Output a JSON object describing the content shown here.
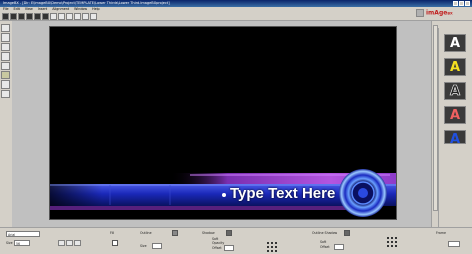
{
  "window": {
    "title": "ImageBX - [Dir: E\\ImageBX\\Demo\\Project\\TEMPLATE\\Lower Thirds\\Lower Third.ImageBXproject]"
  },
  "menu": [
    "File",
    "Edit",
    "View",
    "Insert",
    "Alignment",
    "Window",
    "Help"
  ],
  "logo": {
    "text": "imAge",
    "suffix": "BX"
  },
  "canvas": {
    "headline": "Type Text Here"
  },
  "styles": [
    {
      "glyph": "A",
      "color": "#ffffff"
    },
    {
      "glyph": "A",
      "color": "#f5e020"
    },
    {
      "glyph": "A",
      "color": "#202020"
    },
    {
      "glyph": "A",
      "color": "#f04040"
    },
    {
      "glyph": "A",
      "color": "#2050e0"
    }
  ],
  "properties": {
    "font_name": "Arial",
    "size_label": "Size",
    "size_value": "56",
    "fill_label": "Fill",
    "outline_label": "Outline",
    "outline_size_label": "Size",
    "shadow_label": "Shadow",
    "shadow_soft_label": "Soft",
    "shadow_opacity_label": "Opacity",
    "shadow_offset_label": "Offset",
    "outline_shadow_label": "Outline Shadow",
    "os_soft_label": "Soft",
    "os_offset_label": "Offset",
    "frame_label": "Frame"
  },
  "colors": {
    "canvas": "#000000",
    "bar_purple": "#9a3ec8",
    "bar_blue": "#1a2ac0",
    "text": "#ffffff",
    "accent": "#3a6ea5"
  }
}
